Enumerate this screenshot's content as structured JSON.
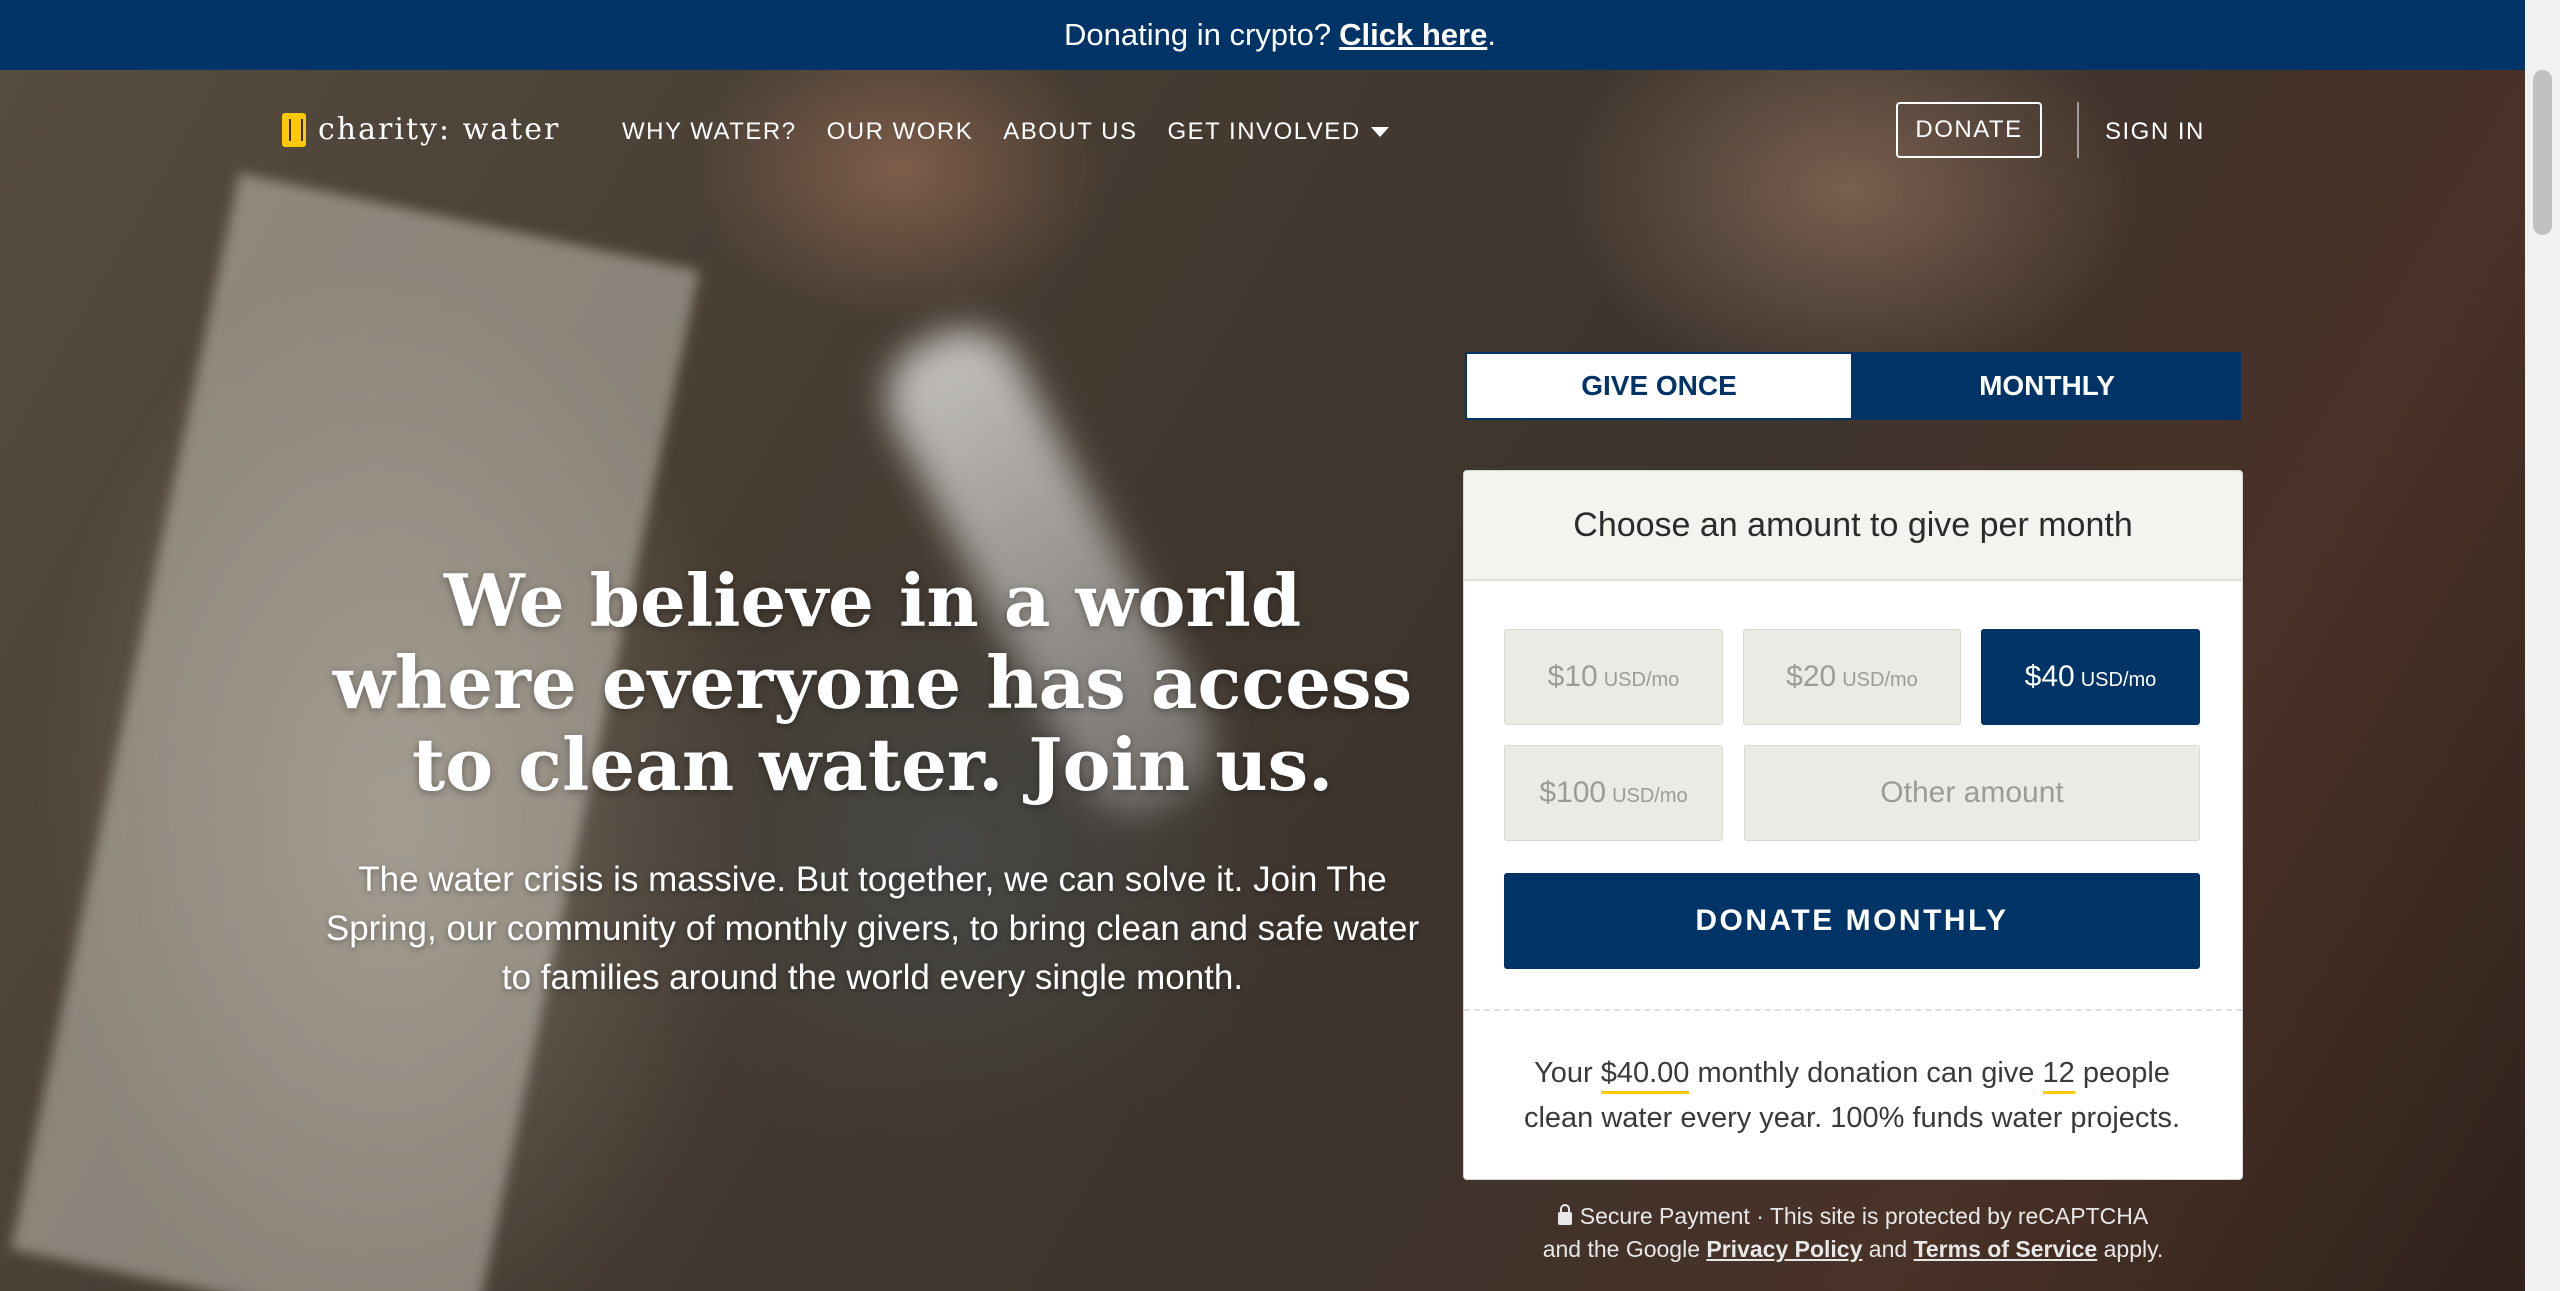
{
  "banner": {
    "text": "Donating in crypto?",
    "link": "Click here",
    "suffix": "."
  },
  "nav": {
    "logo": "charity: water",
    "links": [
      "WHY WATER?",
      "OUR WORK",
      "ABOUT US",
      "GET INVOLVED"
    ],
    "donate": "DONATE",
    "signin": "SIGN IN"
  },
  "hero": {
    "headline": "We believe in a world where everyone has access to clean water. Join us.",
    "subtext": "The water crisis is massive. But together, we can solve it. Join The Spring, our community of monthly givers, to bring clean and safe water to families around the world every single month."
  },
  "form": {
    "tabs": {
      "once": "GIVE ONCE",
      "monthly": "MONTHLY"
    },
    "header": "Choose an amount to give per month",
    "amounts": [
      {
        "value": "$10",
        "unit": "USD/mo"
      },
      {
        "value": "$20",
        "unit": "USD/mo"
      },
      {
        "value": "$40",
        "unit": "USD/mo"
      },
      {
        "value": "$100",
        "unit": "USD/mo"
      }
    ],
    "selected_amount": "$40",
    "other": "Other amount",
    "submit": "DONATE MONTHLY",
    "impact": {
      "pre": "Your ",
      "amount": "$40.00",
      "mid": " monthly donation can give ",
      "people": "12",
      "post": " people clean water every year. 100% funds water projects."
    }
  },
  "secure": {
    "line1": "Secure Payment · This site is protected by reCAPTCHA",
    "pre": "and the Google ",
    "privacy": "Privacy Policy",
    "and": " and ",
    "terms": "Terms of Service",
    "post": " apply."
  },
  "colors": {
    "navy": "#003366",
    "accent": "#ffc907"
  }
}
